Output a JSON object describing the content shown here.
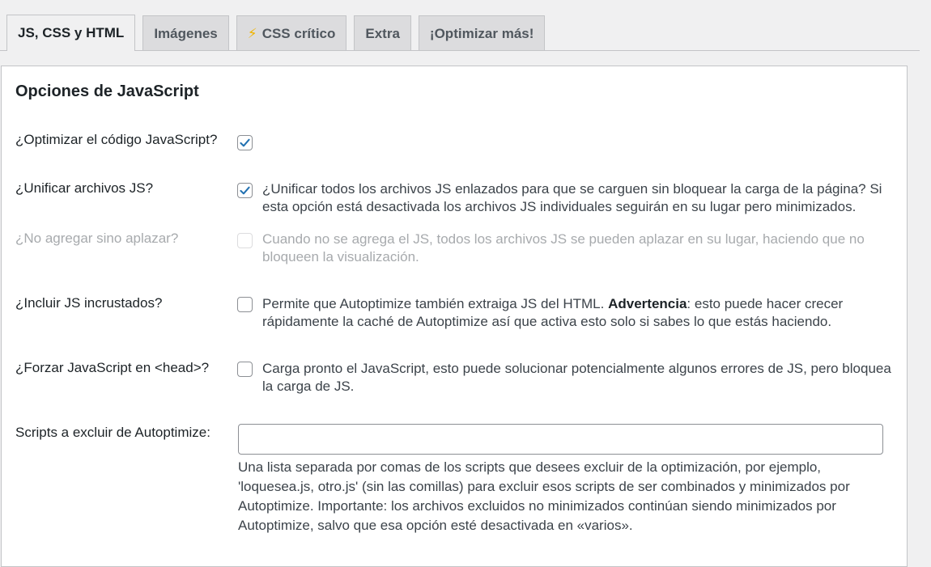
{
  "tabs": [
    {
      "label": "JS, CSS y HTML",
      "active": true
    },
    {
      "label": "Imágenes"
    },
    {
      "label": "CSS crítico",
      "icon": "lightning-bolt-icon"
    },
    {
      "label": "Extra"
    },
    {
      "label": "¡Optimizar más!"
    }
  ],
  "section": {
    "title": "Opciones de JavaScript"
  },
  "options": {
    "optimize_js": {
      "label": "¿Optimizar el código JavaScript?",
      "checked": true
    },
    "aggregate_js": {
      "label": "¿Unificar archivos JS?",
      "checked": true,
      "description": "¿Unificar todos los archivos JS enlazados para que se carguen sin bloquear la carga de la página? Si esta opción está desactivada los archivos JS individuales seguirán en su lugar pero minimizados."
    },
    "defer_js": {
      "label": "¿No agregar sino aplazar?",
      "checked": false,
      "disabled": true,
      "description": "Cuando no se agrega el JS, todos los archivos JS se pueden aplazar en su lugar, haciendo que no bloqueen la visualización."
    },
    "inline_js": {
      "label": "¿Incluir JS incrustados?",
      "checked": false,
      "description_prefix": "Permite que Autoptimize también extraiga JS del HTML. ",
      "description_bold": "Advertencia",
      "description_suffix": ": esto puede hacer crecer rápidamente la caché de Autoptimize así que activa esto solo si sabes lo que estás haciendo."
    },
    "force_head": {
      "label": "¿Forzar JavaScript en <head>?",
      "checked": false,
      "description": "Carga pronto el JavaScript, esto puede solucionar potencialmente algunos errores de JS, pero bloquea la carga de JS."
    },
    "exclude": {
      "label": "Scripts a excluir de Autoptimize:",
      "value": "",
      "help": "Una lista separada por comas de los scripts que desees excluir de la optimización, por ejemplo, 'loquesea.js, otro.js' (sin las comillas) para excluir esos scripts de ser combinados y minimizados por Autoptimize. Importante: los archivos excluidos no minimizados continúan siendo minimizados por Autoptimize, salvo que esa opción esté desactivada en «varios»."
    }
  },
  "colors": {
    "checkmark": "#2271b1",
    "bolt": "#f0b400",
    "disabled_text": "#a7aaad"
  }
}
